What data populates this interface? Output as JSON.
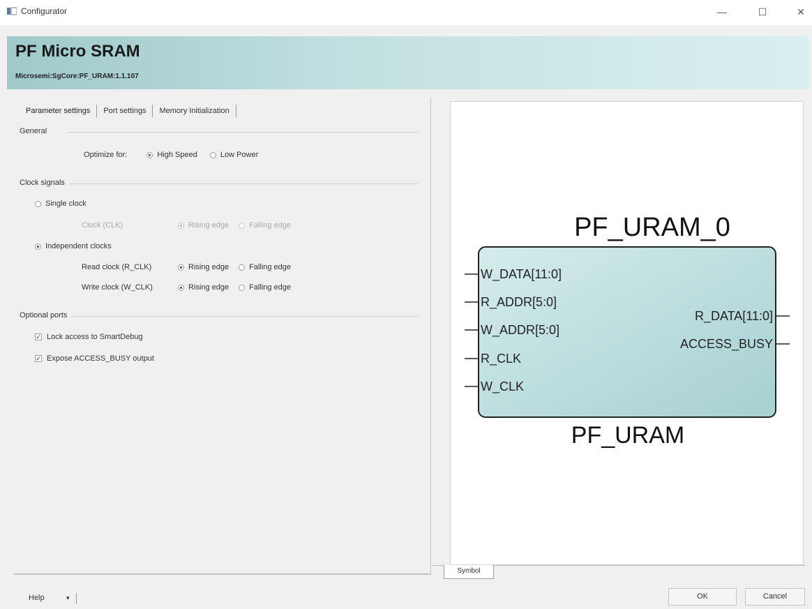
{
  "window": {
    "title": "Configurator",
    "minimize": "—",
    "maximize": "☐",
    "close": "✕"
  },
  "header": {
    "title": "PF Micro SRAM",
    "subtitle": "Microsemi:SgCore:PF_URAM:1.1.107"
  },
  "tabs": [
    "Parameter settings",
    "Port settings",
    "Memory Initialization"
  ],
  "general": {
    "label": "General",
    "optimize_label": "Optimize for:",
    "options": [
      {
        "label": "High Speed",
        "selected": true
      },
      {
        "label": "Low Power",
        "selected": false
      }
    ]
  },
  "clock_signals": {
    "label": "Clock signals",
    "single_clock": {
      "label": "Single clock",
      "selected": false
    },
    "single_clock_row": {
      "label": "Clock (CLK)",
      "enabled": false,
      "options": [
        {
          "label": "Rising edge",
          "selected": true
        },
        {
          "label": "Falling edge",
          "selected": false
        }
      ]
    },
    "independent_clocks": {
      "label": "Independent clocks",
      "selected": true
    },
    "read_clock": {
      "label": "Read clock (R_CLK)",
      "options": [
        {
          "label": "Rising edge",
          "selected": true
        },
        {
          "label": "Falling edge",
          "selected": false
        }
      ]
    },
    "write_clock": {
      "label": "Write clock (W_CLK)",
      "options": [
        {
          "label": "Rising edge",
          "selected": true
        },
        {
          "label": "Falling edge",
          "selected": false
        }
      ]
    }
  },
  "optional_ports": {
    "label": "Optional ports",
    "items": [
      {
        "label": "Lock access to SmartDebug",
        "checked": true
      },
      {
        "label": "Expose ACCESS_BUSY output",
        "checked": true
      }
    ]
  },
  "symbol": {
    "instance_name": "PF_URAM_0",
    "component_name": "PF_URAM",
    "left_ports": [
      "W_DATA[11:0]",
      "R_ADDR[5:0]",
      "W_ADDR[5:0]",
      "R_CLK",
      "W_CLK"
    ],
    "right_ports": [
      "R_DATA[11:0]",
      "ACCESS_BUSY"
    ],
    "tab_label": "Symbol",
    "block_color_left": "#d4ecec",
    "block_color_right": "#a7d0d1"
  },
  "footer": {
    "help_label": "Help",
    "help_arrow": "▾",
    "ok_label": "OK",
    "cancel_label": "Cancel"
  }
}
